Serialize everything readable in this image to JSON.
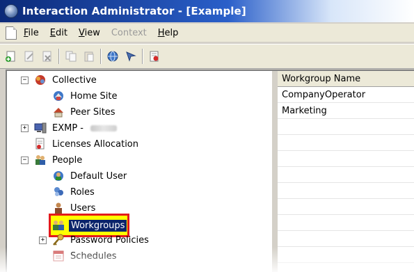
{
  "window": {
    "title": "Interaction Administrator - [Example]",
    "icon": "interaction-admin-globe-icon"
  },
  "menu": {
    "items": [
      {
        "label": "File",
        "enabled": true
      },
      {
        "label": "Edit",
        "enabled": true
      },
      {
        "label": "View",
        "enabled": true
      },
      {
        "label": "Context",
        "enabled": false
      },
      {
        "label": "Help",
        "enabled": true
      }
    ]
  },
  "toolbar": {
    "buttons": [
      "new-icon",
      "edit-icon",
      "delete-icon",
      "copy-icon",
      "paste-icon",
      "globe-icon",
      "wand-icon",
      "properties-icon"
    ]
  },
  "tree": {
    "nodes": [
      {
        "label": "Collective",
        "icon": "collective-icon",
        "expander": "minus"
      },
      {
        "label": "Home Site",
        "icon": "home-site-icon"
      },
      {
        "label": "Peer Sites",
        "icon": "peer-sites-icon"
      },
      {
        "label": "EXMP -",
        "icon": "server-icon",
        "expander": "plus"
      },
      {
        "label": "Licenses Allocation",
        "icon": "license-icon"
      },
      {
        "label": "People",
        "icon": "people-icon",
        "expander": "minus"
      },
      {
        "label": "Default User",
        "icon": "default-user-icon"
      },
      {
        "label": "Roles",
        "icon": "roles-icon"
      },
      {
        "label": "Users",
        "icon": "users-icon"
      },
      {
        "label": "Workgroups",
        "icon": "workgroups-icon",
        "selected": true
      },
      {
        "label": "Password Policies",
        "icon": "key-icon",
        "expander": "plus"
      },
      {
        "label": "Schedules",
        "icon": "schedules-icon"
      }
    ]
  },
  "list": {
    "column_header": "Workgroup Name",
    "rows": [
      "CompanyOperator",
      "Marketing"
    ]
  },
  "colors": {
    "titlebar_start": "#0b2a78",
    "selection_bg": "#0a246a",
    "highlight_box": "#e31b1b",
    "highlight_fill": "#ffff00"
  }
}
